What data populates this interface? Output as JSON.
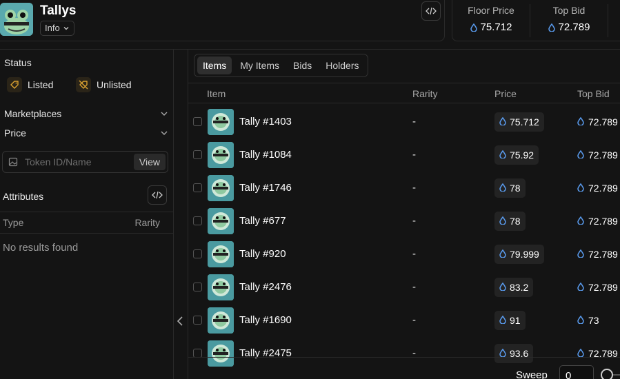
{
  "collection": {
    "title": "Tallys",
    "info_label": "Info"
  },
  "stats": {
    "floor_label": "Floor Price",
    "floor_value": "75.712",
    "topbid_label": "Top Bid",
    "topbid_value": "72.789"
  },
  "sidebar": {
    "status_label": "Status",
    "listed_label": "Listed",
    "unlisted_label": "Unlisted",
    "marketplaces_label": "Marketplaces",
    "price_label": "Price",
    "token_placeholder": "Token ID/Name",
    "view_label": "View",
    "attributes_label": "Attributes",
    "type_label": "Type",
    "rarity_label": "Rarity",
    "no_results": "No results found"
  },
  "tabs": [
    "Items",
    "My Items",
    "Bids",
    "Holders"
  ],
  "table": {
    "headers": {
      "item": "Item",
      "rarity": "Rarity",
      "price": "Price",
      "top_bid": "Top Bid"
    },
    "rows": [
      {
        "name": "Tally #1403",
        "rarity": "-",
        "price": "75.712",
        "top_bid": "72.789"
      },
      {
        "name": "Tally #1084",
        "rarity": "-",
        "price": "75.92",
        "top_bid": "72.789"
      },
      {
        "name": "Tally #1746",
        "rarity": "-",
        "price": "78",
        "top_bid": "72.789"
      },
      {
        "name": "Tally #677",
        "rarity": "-",
        "price": "78",
        "top_bid": "72.789"
      },
      {
        "name": "Tally #920",
        "rarity": "-",
        "price": "79.999",
        "top_bid": "72.789"
      },
      {
        "name": "Tally #2476",
        "rarity": "-",
        "price": "83.2",
        "top_bid": "72.789"
      },
      {
        "name": "Tally #1690",
        "rarity": "-",
        "price": "91",
        "top_bid": "73"
      },
      {
        "name": "Tally #2475",
        "rarity": "-",
        "price": "93.6",
        "top_bid": "72.789"
      }
    ]
  },
  "footer": {
    "sweep_label": "Sweep",
    "sweep_value": "0"
  },
  "colors": {
    "background": "#141414",
    "accent_token": "#5a9cf0",
    "listed_icon": "#d9a030",
    "avatar_bg": "#4a9aa0"
  }
}
